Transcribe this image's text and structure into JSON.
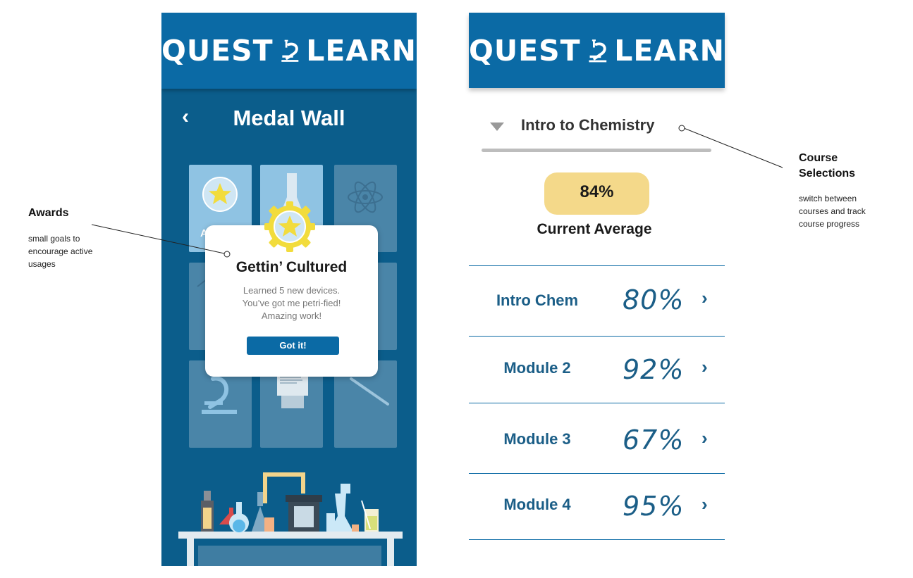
{
  "brand": {
    "left_word": "QUEST",
    "right_word": "LEARN"
  },
  "medal_wall": {
    "title": "Medal Wall",
    "back_icon": "chevron-left-icon",
    "popup": {
      "title": "Gettin’ Cultured",
      "lines": [
        "Learned 5 new devices.",
        "You’ve got me petri-fied!",
        "Amazing work!"
      ],
      "button_label": "Got it!"
    }
  },
  "course_view": {
    "course_name": "Intro to Chemistry",
    "average_value": "84%",
    "average_label": "Current Average",
    "modules": [
      {
        "name": "Intro Chem",
        "percent": "80%"
      },
      {
        "name": "Module 2",
        "percent": "92%"
      },
      {
        "name": "Module 3",
        "percent": "67%"
      },
      {
        "name": "Module 4",
        "percent": "95%"
      }
    ]
  },
  "annotations": {
    "awards": {
      "title": "Awards",
      "text": [
        "small goals to",
        "encourage active",
        "usages"
      ]
    },
    "course": {
      "title": [
        "Course",
        "Selections"
      ],
      "text": [
        "switch between",
        "courses and track",
        "course progress"
      ]
    }
  },
  "colors": {
    "brand_blue": "#0b6aa5",
    "wall_blue": "#0b5d8b",
    "average_yellow": "#f4d98a",
    "medal_gold": "#f2dc3c"
  }
}
